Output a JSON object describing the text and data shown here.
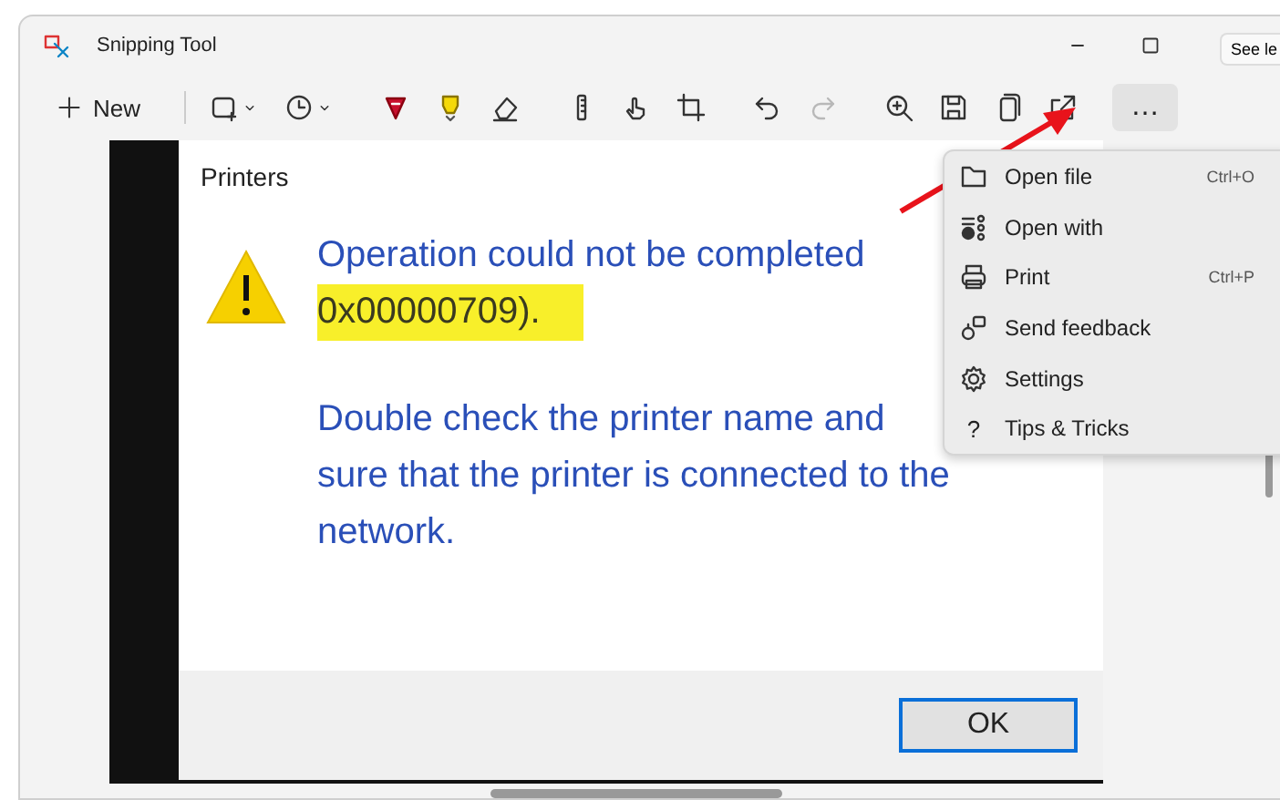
{
  "window": {
    "title": "Snipping Tool"
  },
  "tooltip": "See le",
  "toolbar": {
    "new_button": "New",
    "tools": [
      {
        "kind": "rect",
        "disabled": false
      },
      {
        "kind": "timer",
        "disabled": false
      },
      {
        "kind": "pen",
        "disabled": false
      },
      {
        "kind": "highlighter",
        "disabled": false
      },
      {
        "kind": "eraser",
        "disabled": false
      },
      {
        "kind": "ruler",
        "disabled": false
      },
      {
        "kind": "touch",
        "disabled": false
      },
      {
        "kind": "crop",
        "disabled": false
      },
      {
        "kind": "undo",
        "disabled": false
      },
      {
        "kind": "redo",
        "disabled": true
      },
      {
        "kind": "zoom",
        "disabled": false
      },
      {
        "kind": "save",
        "disabled": false
      },
      {
        "kind": "copy",
        "disabled": false
      },
      {
        "kind": "share",
        "disabled": false
      }
    ],
    "more_button": {
      "label": "…",
      "active": true
    }
  },
  "captured_dialog": {
    "title": "Printers",
    "message_lines": [
      "Operation could not be completed"
    ],
    "highlighted_text": "0x00000709).",
    "detail_lines": [
      "Double check the printer name and",
      "sure that the printer is connected to the",
      "network."
    ],
    "ok_button": "OK"
  },
  "menu": [
    {
      "kind": "open-file",
      "label": "Open file",
      "shortcut": "Ctrl+O"
    },
    {
      "kind": "open-with",
      "label": "Open with"
    },
    {
      "kind": "print",
      "label": "Print",
      "shortcut": "Ctrl+P"
    },
    {
      "kind": "feedback",
      "label": "Send feedback"
    },
    {
      "kind": "settings",
      "label": "Settings"
    },
    {
      "kind": "help",
      "glyph": "?",
      "label": "Tips & Tricks"
    }
  ]
}
